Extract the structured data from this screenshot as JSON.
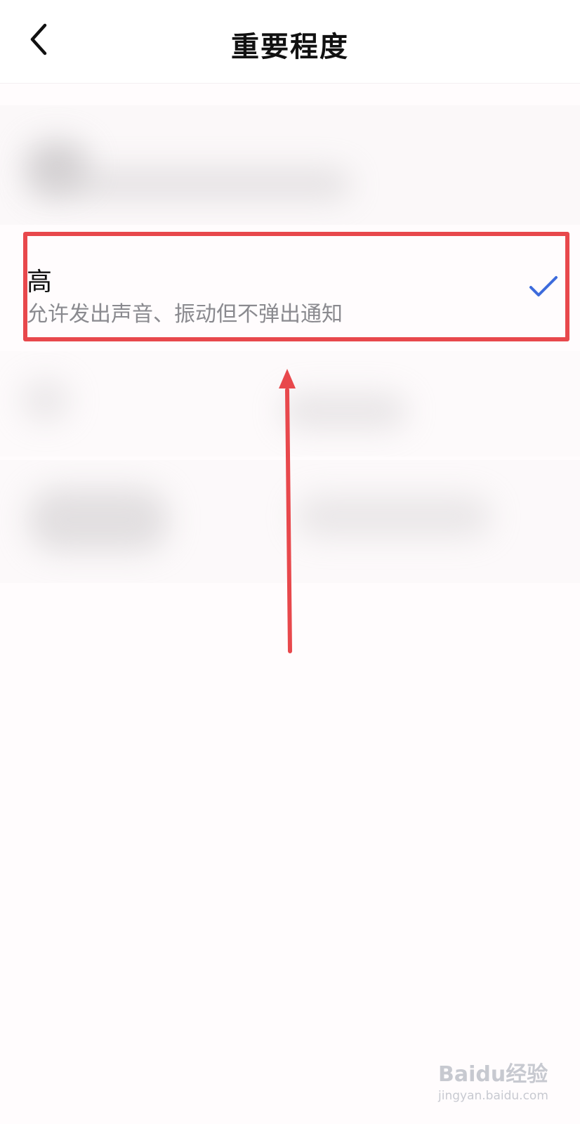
{
  "header": {
    "title": "重要程度",
    "back_icon": "chevron-left-icon"
  },
  "options": [
    {
      "title": "高",
      "description": "允许发出声音、振动但不弹出通知",
      "selected": true,
      "check_icon": "checkmark-icon"
    }
  ],
  "colors": {
    "accent": "#3d6bdc",
    "annotation": "#e8484c",
    "secondary_text": "#8a8a8f"
  },
  "watermark": {
    "logo": "Baidu经验",
    "url": "jingyan.baidu.com"
  }
}
